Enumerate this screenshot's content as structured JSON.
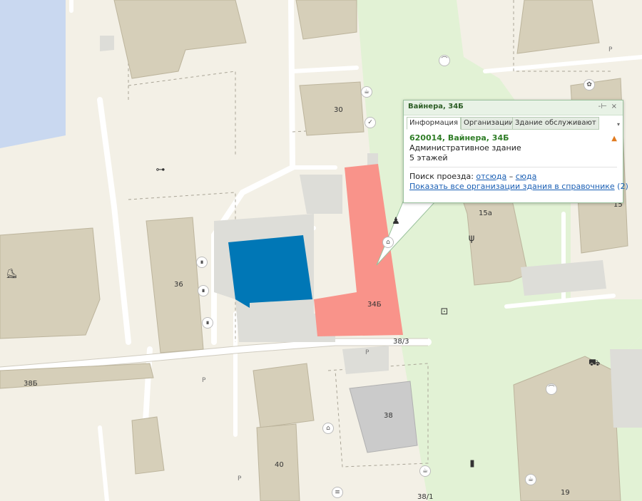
{
  "map": {
    "buildings": {
      "b34b": "34Б",
      "b36": "36",
      "b30": "30",
      "b38b": "38Б",
      "b38": "38",
      "b38_3": "38/3",
      "b40": "40",
      "b38_1": "38/1",
      "b15a": "15а",
      "b15": "15",
      "b19": "19"
    },
    "parking_label": "P",
    "poi_icons": [
      "cafe-icon",
      "sports-icon",
      "bank-icon",
      "person-icon",
      "shop-icon",
      "camera-icon",
      "gym-icon",
      "skate-icon",
      "flower-icon",
      "hanger-icon",
      "restaurant-icon",
      "bicycle-icon",
      "cart-icon"
    ]
  },
  "popup": {
    "title": "Вайнера, 34Б",
    "pin_label": "-⊢",
    "close_label": "×",
    "tabs": [
      "Информация",
      "Организации",
      "Здание обслуживают"
    ],
    "active_tab": "Информация",
    "address": "620014, Вайнера, 34Б",
    "type": "Административное здание",
    "floors": "5 этажей",
    "route_label": "Поиск проезда:",
    "route_from": "отсюда",
    "route_dash": "–",
    "route_to": "сюда",
    "all_orgs_link": "Показать все организации здания в справочнике",
    "all_orgs_count": "(2)",
    "colors": {
      "selected_building": "#f9938a",
      "highlight_building": "#0077b6",
      "pedestrian_zone": "#e2f2d5"
    }
  }
}
